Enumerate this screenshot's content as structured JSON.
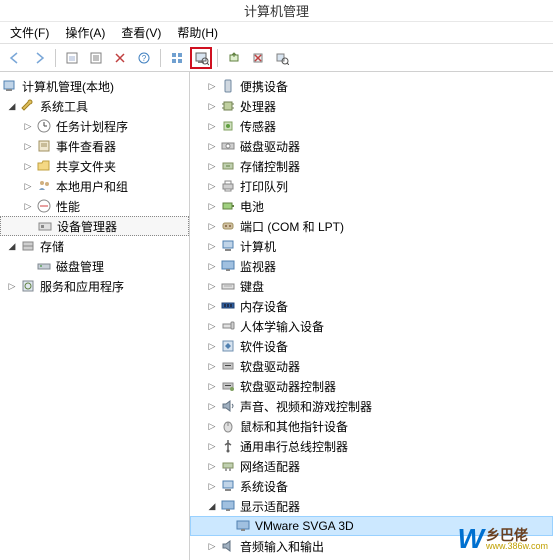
{
  "title": "计算机管理",
  "menu": {
    "file": "文件(F)",
    "action": "操作(A)",
    "view": "查看(V)",
    "help": "帮助(H)"
  },
  "toolbar_icons": [
    "back",
    "forward",
    "up",
    "props",
    "xbox",
    "help",
    "tile",
    "monitor",
    "printer",
    "refresh",
    "scan",
    "remove",
    "server"
  ],
  "left_tree": {
    "root": "计算机管理(本地)",
    "system_tools": "系统工具",
    "task_scheduler": "任务计划程序",
    "event_viewer": "事件查看器",
    "shared_folders": "共享文件夹",
    "local_users": "本地用户和组",
    "performance": "性能",
    "device_manager": "设备管理器",
    "storage": "存储",
    "disk_mgmt": "磁盘管理",
    "services": "服务和应用程序"
  },
  "right_tree": {
    "portable": "便携设备",
    "processors": "处理器",
    "sensors": "传感器",
    "disk_drives": "磁盘驱动器",
    "storage_ctrl": "存储控制器",
    "print_queue": "打印队列",
    "batteries": "电池",
    "ports": "端口 (COM 和 LPT)",
    "computer": "计算机",
    "monitors": "监视器",
    "keyboards": "键盘",
    "memory": "内存设备",
    "hid": "人体学输入设备",
    "software": "软件设备",
    "floppy_drives": "软盘驱动器",
    "floppy_ctrl": "软盘驱动器控制器",
    "sound": "声音、视频和游戏控制器",
    "mice": "鼠标和其他指针设备",
    "usb": "通用串行总线控制器",
    "network": "网络适配器",
    "system": "系统设备",
    "display": "显示适配器",
    "display_child": "VMware SVGA 3D",
    "audio_io": "音频输入和输出"
  },
  "watermark": {
    "cn": "乡巴佬",
    "url": "www.386w.com"
  }
}
